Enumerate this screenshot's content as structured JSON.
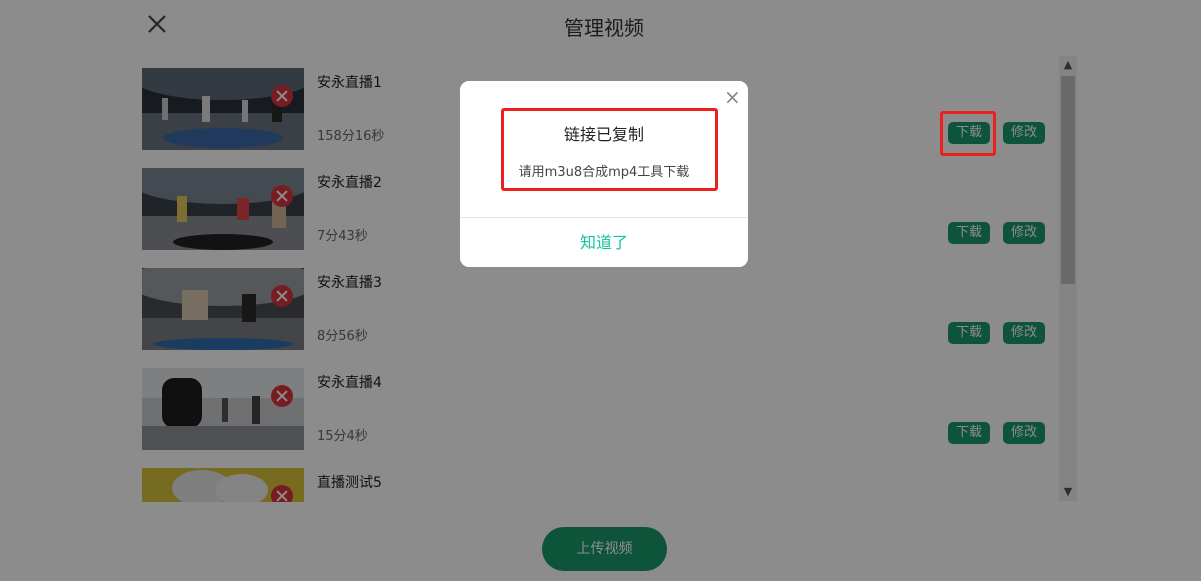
{
  "panel": {
    "title": "管理视频",
    "close_icon": "close-icon",
    "upload_label": "上传视频"
  },
  "videos": [
    {
      "name": "安永直播1",
      "duration": "158分16秒",
      "download_label": "下载",
      "edit_label": "修改"
    },
    {
      "name": "安永直播2",
      "duration": "7分43秒",
      "download_label": "下载",
      "edit_label": "修改"
    },
    {
      "name": "安永直播3",
      "duration": "8分56秒",
      "download_label": "下载",
      "edit_label": "修改"
    },
    {
      "name": "安永直播4",
      "duration": "15分4秒",
      "download_label": "下载",
      "edit_label": "修改"
    },
    {
      "name": "直播测试5",
      "duration": "",
      "download_label": "",
      "edit_label": ""
    }
  ],
  "scrollbar": {
    "up_icon": "▲",
    "down_icon": "▼"
  },
  "dialog": {
    "title": "链接已复制",
    "message": "请用m3u8合成mp4工具下载",
    "close_icon": "×",
    "confirm_label": "知道了"
  },
  "colors": {
    "accent_green": "#1a9a6c",
    "dialog_confirm": "#13c2a0",
    "delete_red": "#d9363e",
    "highlight_red": "#ee1f1f"
  }
}
